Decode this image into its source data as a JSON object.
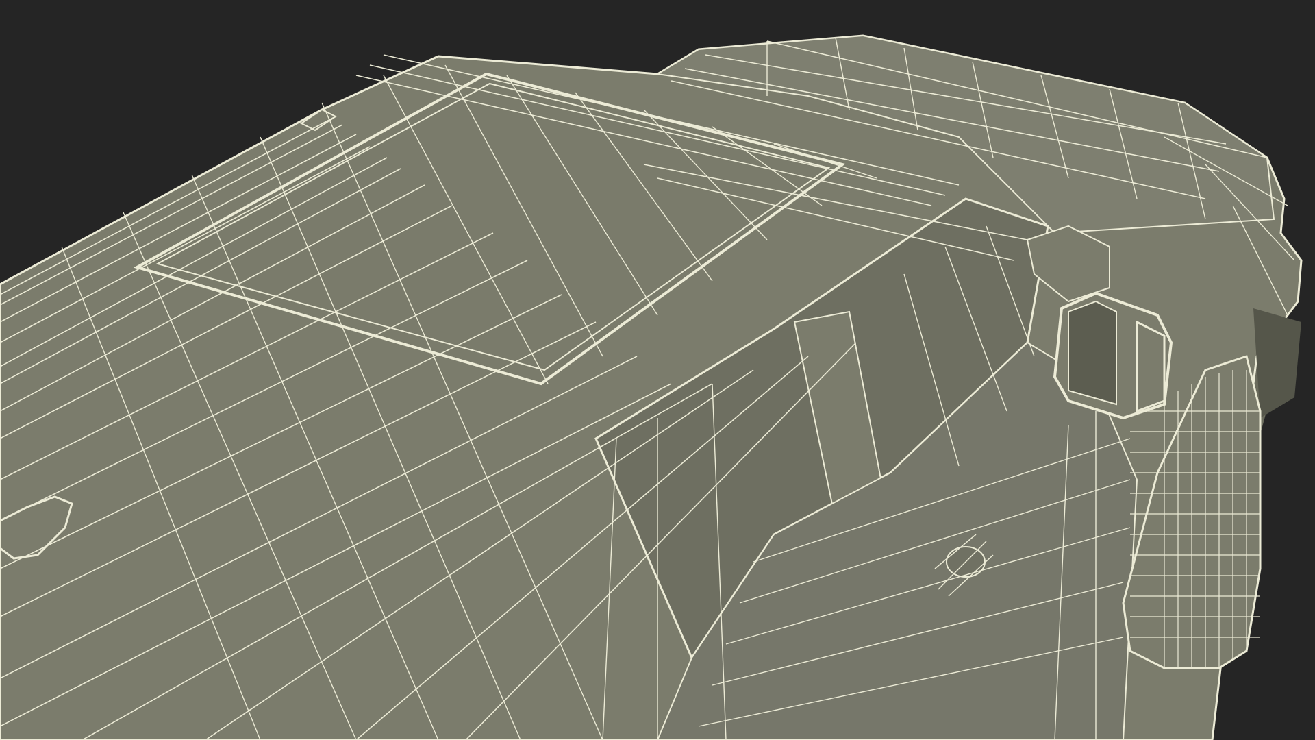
{
  "scene": {
    "subject": "wireframe-render",
    "colors": {
      "background": "#252525",
      "surface": "#7b7c6c",
      "surface_shadow": "#6b6c5d",
      "glass": "#6e6f61",
      "dark_interior": "#5c5d50",
      "wire": "#ecebd6"
    }
  }
}
